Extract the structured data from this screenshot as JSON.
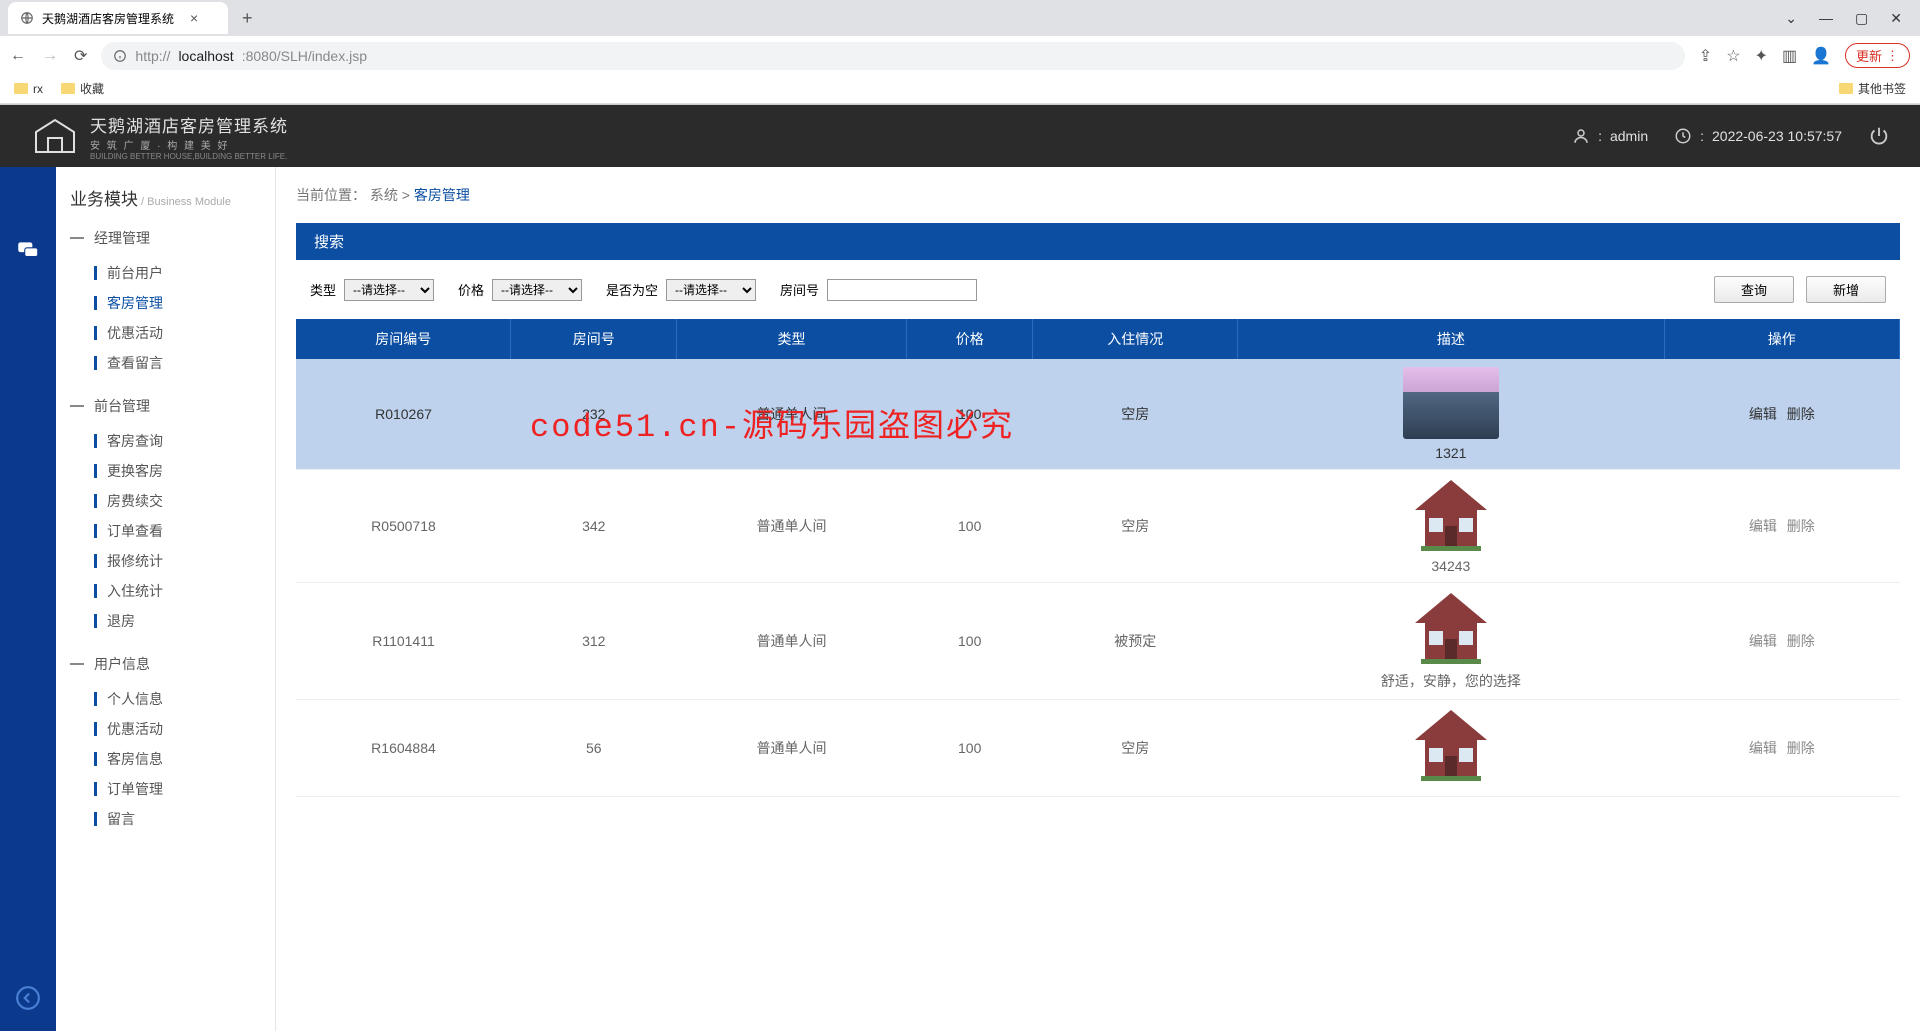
{
  "browser": {
    "tab_title": "天鹅湖酒店客房管理系统",
    "url_host": "localhost",
    "url_port_path": ":8080/SLH/index.jsp",
    "update_btn": "更新",
    "bookmarks": {
      "rx": "rx",
      "fav": "收藏",
      "other": "其他书签"
    }
  },
  "header": {
    "brand": "天鹅湖酒店客房管理系统",
    "brand_sub": "安 筑 广 厦 · 构 建 美 好",
    "brand_sub2": "BUILDING BETTER HOUSE,BUILDING BETTER LIFE.",
    "user": "admin",
    "datetime": "2022-06-23 10:57:57"
  },
  "sidebar": {
    "title": "业务模块",
    "title_en": " / Business Module",
    "groups": [
      {
        "label": "经理管理",
        "items": [
          "前台用户",
          "客房管理",
          "优惠活动",
          "查看留言"
        ],
        "active": 1
      },
      {
        "label": "前台管理",
        "items": [
          "客房查询",
          "更换客房",
          "房费续交",
          "订单查看",
          "报修统计",
          "入住统计",
          "退房"
        ]
      },
      {
        "label": "用户信息",
        "items": [
          "个人信息",
          "优惠活动",
          "客房信息",
          "订单管理",
          "留言"
        ]
      }
    ]
  },
  "breadcrumb": {
    "prefix": "当前位置：",
    "l1": "系统",
    "sep": " > ",
    "l2": "客房管理"
  },
  "search": {
    "title": "搜索",
    "type_label": "类型",
    "type_placeholder": "--请选择--",
    "price_label": "价格",
    "price_placeholder": "--请选择--",
    "empty_label": "是否为空",
    "empty_placeholder": "--请选择--",
    "room_label": "房间号",
    "query_btn": "查询",
    "add_btn": "新增"
  },
  "table": {
    "headers": [
      "房间编号",
      "房间号",
      "类型",
      "价格",
      "入住情况",
      "描述",
      "操作"
    ],
    "rows": [
      {
        "id": "R010267",
        "num": "232",
        "type": "普通单人间",
        "price": "100",
        "status": "空房",
        "desc": "1321",
        "img": "mountain",
        "hl": true
      },
      {
        "id": "R0500718",
        "num": "342",
        "type": "普通单人间",
        "price": "100",
        "status": "空房",
        "desc": "34243",
        "img": "house"
      },
      {
        "id": "R1101411",
        "num": "312",
        "type": "普通单人间",
        "price": "100",
        "status": "被预定",
        "desc": "舒适，安静，您的选择",
        "img": "house"
      },
      {
        "id": "R1604884",
        "num": "56",
        "type": "普通单人间",
        "price": "100",
        "status": "空房",
        "desc": "",
        "img": "house"
      }
    ],
    "op_edit": "编辑",
    "op_del": "删除"
  },
  "watermark": "code51.cn-源码乐园盗图必究"
}
